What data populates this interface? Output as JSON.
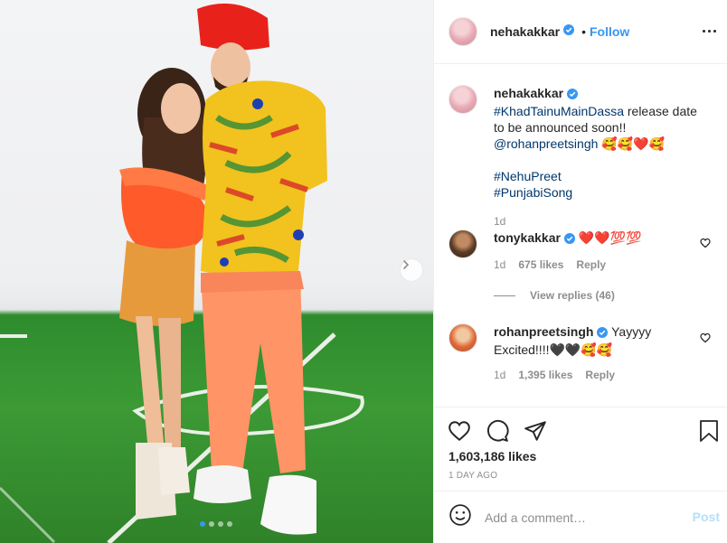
{
  "post": {
    "image_alt": "Couple posing on a football field",
    "carousel_dots": 4,
    "active_dot": 0
  },
  "header": {
    "username": "nehakakkar",
    "follow_separator": "•",
    "follow_label": "Follow"
  },
  "caption": {
    "username": "nehakakkar",
    "hashtag_main": "#KhadTainuMainDassa",
    "line1": "release date to be announced soon!!",
    "mention": "@rohanpreetsingh",
    "mention_emoji": "🥰🥰❤️🥰",
    "hashtag_2": "#NehuPreet",
    "hashtag_3": "#PunjabiSong",
    "time": "1d"
  },
  "comments": [
    {
      "username": "tonykakkar",
      "text": "❤️❤️💯💯",
      "time": "1d",
      "likes": "675 likes",
      "reply_label": "Reply",
      "view_replies": "View replies (46)"
    },
    {
      "username": "rohanpreetsingh",
      "text": "Yayyyy Excited!!!!🖤🖤🥰🥰",
      "time": "1d",
      "likes": "1,395 likes",
      "reply_label": "Reply"
    }
  ],
  "actions": {
    "likes_count": "1,603,186 likes",
    "age": "1 DAY AGO"
  },
  "comment_box": {
    "placeholder": "Add a comment…",
    "post_label": "Post"
  },
  "colors": {
    "link_blue": "#3897f0",
    "hashtag": "#00376b",
    "muted": "#8e8e8e",
    "post_disabled": "#b2dffc"
  }
}
